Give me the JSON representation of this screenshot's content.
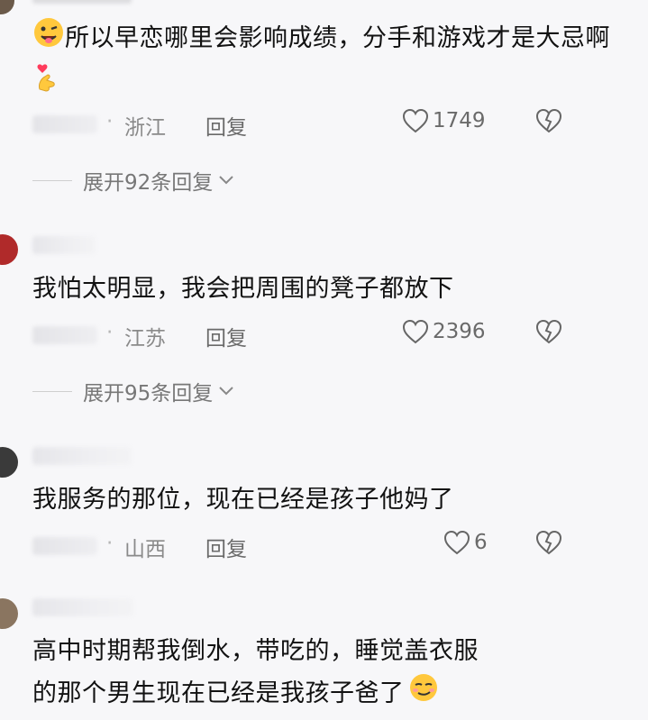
{
  "comments": [
    {
      "text": "所以早恋哪里会影响成绩，分手和游戏才是大忌啊",
      "region": "浙江",
      "reply": "回复",
      "likes": "1749",
      "expand": "展开92条回复"
    },
    {
      "text": "我怕太明显，我会把周围的凳子都放下",
      "region": "江苏",
      "reply": "回复",
      "likes": "2396",
      "expand": "展开95条回复"
    },
    {
      "text": "我服务的那位，现在已经是孩子他妈了",
      "region": "山西",
      "reply": "回复",
      "likes": "6"
    },
    {
      "text_line1": "高中时期帮我倒水，带吃的，睡觉盖衣服",
      "text_line2": "的那个男生现在已经是我孩子爸了"
    }
  ],
  "separator": "·",
  "colors": {
    "background": "#f7f7f9",
    "text": "#121212",
    "meta": "#8a8a8a"
  }
}
